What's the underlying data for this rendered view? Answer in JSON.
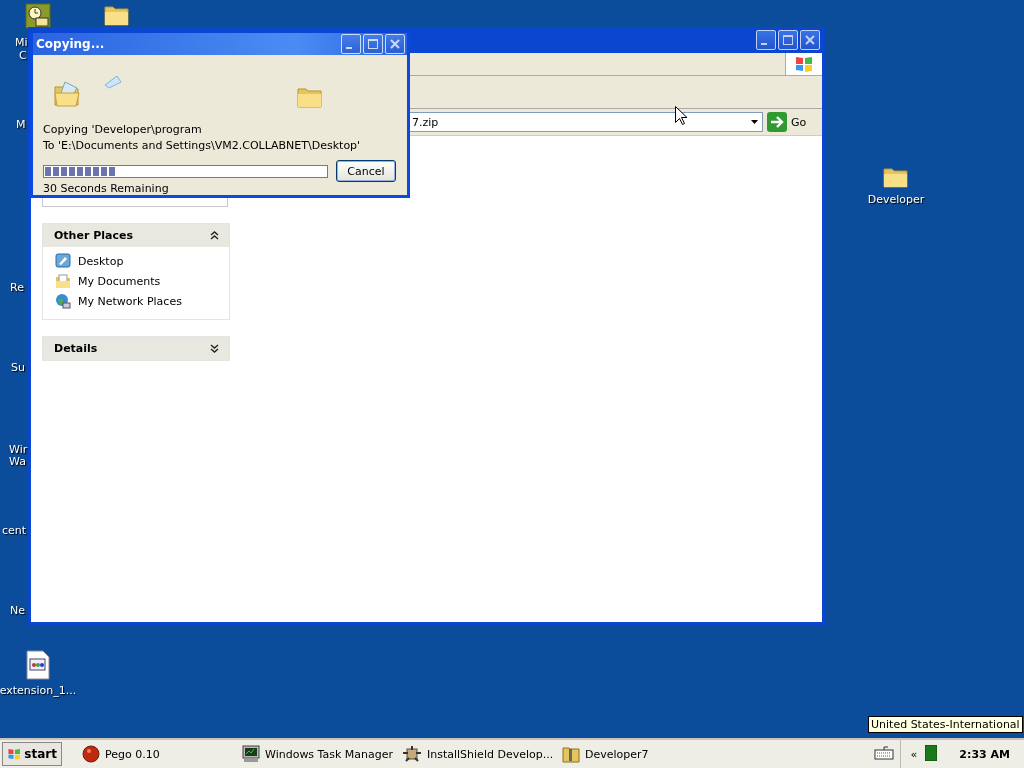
{
  "desktop_icons": [
    {
      "kind": "clock"
    },
    {
      "kind": "folder"
    },
    {
      "kind": "folder",
      "label": "Developer"
    },
    {
      "kind": "document",
      "label": "extension_1..."
    }
  ],
  "clipped_labels": [
    "Mi",
    "C",
    "M",
    "Re",
    "Su",
    "Wir",
    "Wa",
    "cent",
    "Ne"
  ],
  "explorer": {
    "address": "7.zip",
    "go": "Go",
    "other_places": {
      "title": "Other Places",
      "expanded": true,
      "items": [
        {
          "kind": "desktop",
          "label": "Desktop"
        },
        {
          "kind": "documents",
          "label": "My Documents"
        },
        {
          "kind": "network",
          "label": "My Network Places"
        }
      ]
    },
    "details": {
      "title": "Details",
      "expanded": false
    }
  },
  "copy_dialog": {
    "title": "Copying...",
    "line1": "Copying 'Developer\\program",
    "line2": "To 'E:\\Documents and Settings\\VM2.COLLABNET\\Desktop'",
    "level": 0.25,
    "remaining": "30 Seconds Remaining",
    "cancel": "Cancel"
  },
  "tooltip": "United States-International",
  "taskbar": {
    "start": "start",
    "tasks": [
      {
        "kind": "pego",
        "label": "Pego 0.10"
      },
      {
        "kind": "monitor",
        "label": "Windows Task Manager"
      },
      {
        "kind": "installer",
        "label": "InstallShield Develop..."
      },
      {
        "kind": "zipfolder",
        "label": "Developer7"
      }
    ],
    "chevron": "«",
    "clock": "2:33 AM"
  }
}
